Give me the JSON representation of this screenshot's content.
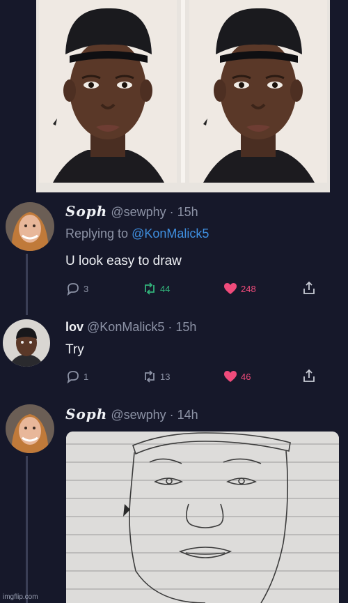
{
  "tweets": [
    {
      "display_name": "Soph",
      "handle": "@sewphy",
      "time": "· 15h",
      "replying_prefix": "Replying to ",
      "replying_to": "@KonMalick5",
      "text": "U look easy to draw",
      "replies": "3",
      "retweets": "44",
      "likes": "248"
    },
    {
      "display_name": "lov",
      "handle": "@KonMalick5",
      "time": "· 15h",
      "text": "Try",
      "replies": "1",
      "retweets": "13",
      "likes": "46"
    },
    {
      "display_name": "Soph",
      "handle": "@sewphy",
      "time": "· 14h"
    }
  ],
  "watermark": "imgflip.com",
  "colors": {
    "background": "#16182a",
    "mention": "#3f8fe0",
    "retweet": "#32b27a",
    "like": "#ef4b7b",
    "secondary_text": "#8d93a6"
  }
}
